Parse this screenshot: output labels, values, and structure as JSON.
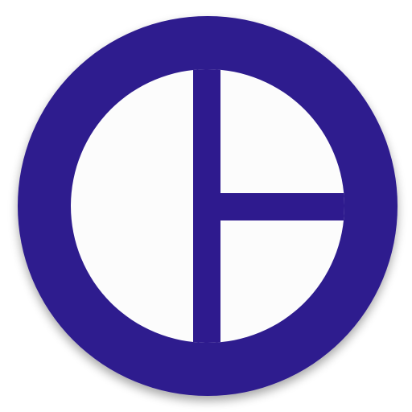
{
  "app_icon": {
    "icon": "circle-split-logo-icon",
    "colors": {
      "ring": "#2E1A8E",
      "fill": "#FCFCFC",
      "background": "#FFFFFF"
    }
  }
}
